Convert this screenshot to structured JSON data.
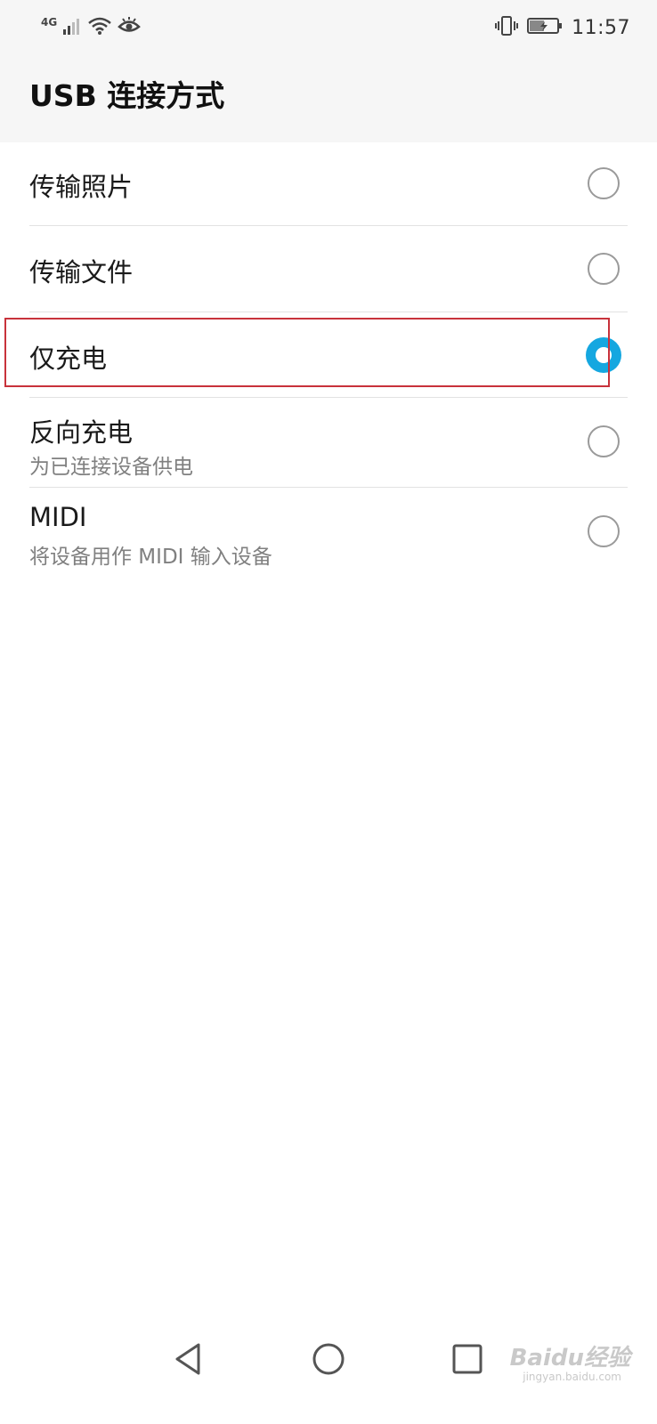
{
  "status_bar": {
    "network": "4G",
    "time": "11:57",
    "icons": [
      "signal-icon",
      "wifi-icon",
      "eye-icon",
      "vibrate-icon",
      "battery-charging-icon"
    ]
  },
  "header": {
    "title": "USB 连接方式"
  },
  "options": [
    {
      "title": "传输照片",
      "subtitle": "",
      "checked": false
    },
    {
      "title": "传输文件",
      "subtitle": "",
      "checked": false
    },
    {
      "title": "仅充电",
      "subtitle": "",
      "checked": true
    },
    {
      "title": "反向充电",
      "subtitle": "为已连接设备供电",
      "checked": false
    },
    {
      "title": "MIDI",
      "subtitle": "将设备用作 MIDI 输入设备",
      "checked": false
    }
  ],
  "nav": {
    "buttons": [
      "back-icon",
      "home-icon",
      "recents-icon"
    ]
  },
  "watermark": {
    "brand": "Baidu经验",
    "site": "jingyan.baidu.com"
  },
  "colors": {
    "accent": "#15a7e0",
    "highlight": "#c8323b",
    "header_bg": "#f6f6f6"
  }
}
